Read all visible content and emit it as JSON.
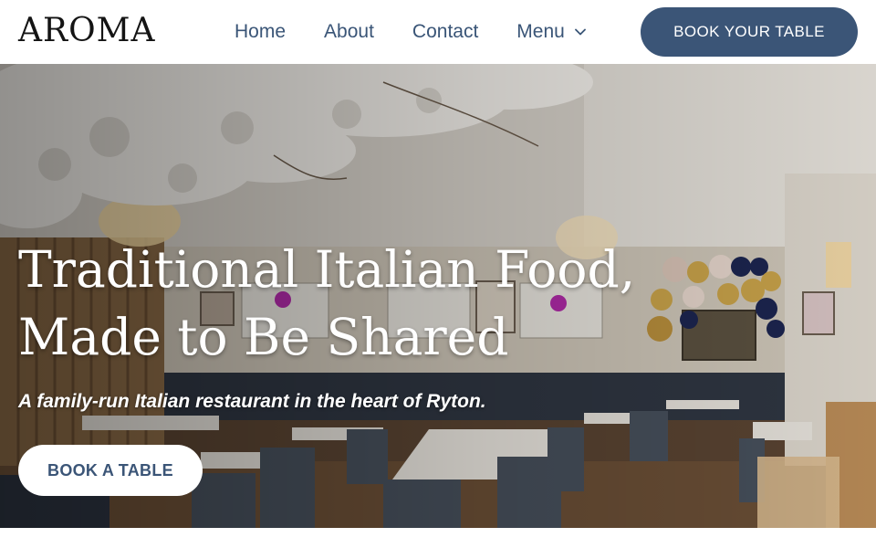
{
  "brand": {
    "logo_text": "AROMA"
  },
  "nav": {
    "items": [
      {
        "label": "Home"
      },
      {
        "label": "About"
      },
      {
        "label": "Contact"
      },
      {
        "label": "Menu",
        "has_dropdown": true,
        "icon": "chevron-down-icon"
      }
    ],
    "cta_label": "BOOK YOUR TABLE"
  },
  "hero": {
    "title_line1": "Traditional Italian Food,",
    "title_line2": "Made to Be Shared",
    "subtitle": "A family-run Italian restaurant in the heart of Ryton.",
    "cta_label": "BOOK A TABLE",
    "image": "restaurant-interior-with-blossom-ceiling-and-balloons"
  },
  "colors": {
    "accent": "#3b5577",
    "nav_text": "#3a5577",
    "header_bg": "#ffffff",
    "hero_text": "#ffffff"
  }
}
